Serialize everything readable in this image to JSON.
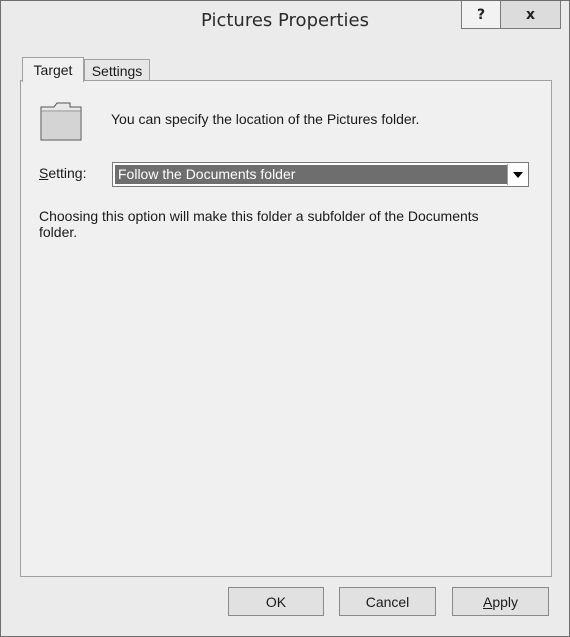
{
  "window": {
    "title": "Pictures Properties",
    "help_label": "?",
    "close_label": "x"
  },
  "tabs": [
    {
      "label": "Target",
      "selected": true
    },
    {
      "label": "Settings",
      "selected": false
    }
  ],
  "target": {
    "description": "You can specify the location of the Pictures folder.",
    "setting_label_accel": "S",
    "setting_label_rest": "etting:",
    "setting_value": "Follow the Documents folder",
    "explanation": "Choosing this option will make this folder a subfolder of the Documents folder."
  },
  "buttons": {
    "ok": "OK",
    "cancel": "Cancel",
    "apply_accel": "A",
    "apply_rest": "pply"
  },
  "icons": {
    "folder": "folder-icon",
    "dropdown": "chevron-down-icon"
  }
}
